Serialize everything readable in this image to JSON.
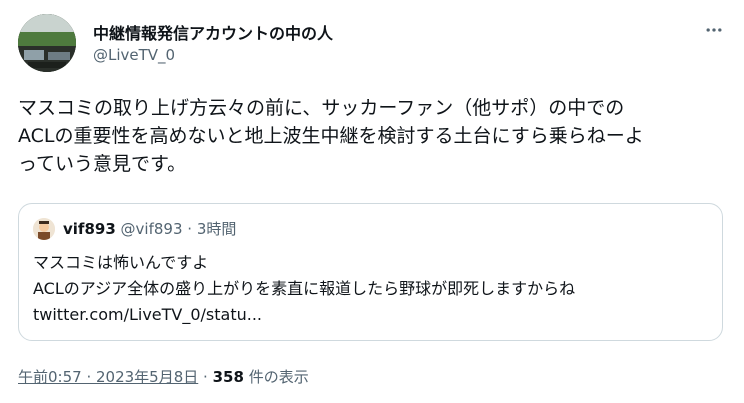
{
  "author": {
    "display_name": "中継情報発信アカウントの中の人",
    "handle": "@LiveTV_0"
  },
  "more_icon": "more-horizontal-icon",
  "tweet": {
    "text": "マスコミの取り上げ方云々の前に、サッカーファン（他サポ）の中での\nACLの重要性を高めないと地上波生中継を検討する土台にすら乗らねーよ\nっていう意見です。"
  },
  "quote": {
    "display_name": "vif893",
    "handle": "@vif893",
    "separator": "·",
    "time": "3時間",
    "lines": [
      "マスコミは怖いんですよ",
      "ACLのアジア全体の盛り上がりを素直に報道したら野球が即死しますからね",
      "twitter.com/LiveTV_0/statu..."
    ]
  },
  "meta": {
    "timestamp": "午前0:57 · 2023年5月8日",
    "separator": "·",
    "views_count": "358",
    "views_label": "件の表示"
  }
}
